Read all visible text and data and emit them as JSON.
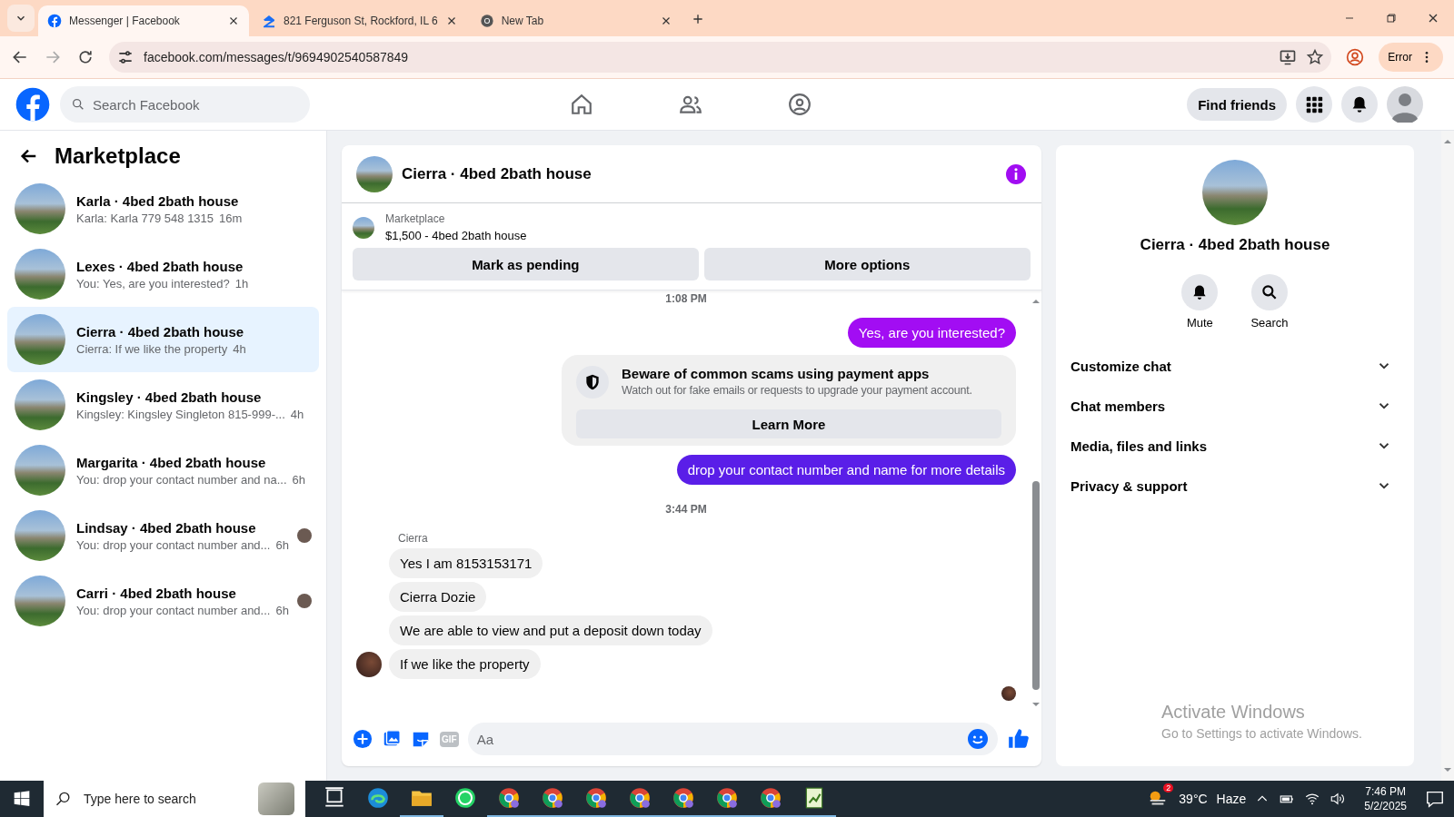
{
  "browser": {
    "tabs": [
      {
        "title": "Messenger | Facebook",
        "kind": "facebook",
        "selected": true
      },
      {
        "title": "821 Ferguson St, Rockford, IL 6",
        "kind": "realestate",
        "selected": false
      },
      {
        "title": "New Tab",
        "kind": "newtab",
        "selected": false
      }
    ],
    "url": "facebook.com/messages/t/9694902540587849",
    "profile_status": "Error"
  },
  "header": {
    "search_placeholder": "Search Facebook",
    "find_friends": "Find friends"
  },
  "sidebar": {
    "title": "Marketplace",
    "conversations": [
      {
        "name": "Karla · 4bed 2bath house",
        "preview": "Karla: Karla 779 548 1315",
        "time": "16m",
        "selected": false,
        "seen": false
      },
      {
        "name": "Lexes · 4bed 2bath house",
        "preview": "You: Yes, are you interested?",
        "time": "1h",
        "selected": false,
        "seen": false
      },
      {
        "name": "Cierra · 4bed 2bath house",
        "preview": "Cierra: If we like the property",
        "time": "4h",
        "selected": true,
        "seen": false
      },
      {
        "name": "Kingsley · 4bed 2bath house",
        "preview": "Kingsley: Kingsley Singleton 815-999-...",
        "time": "4h",
        "selected": false,
        "seen": false
      },
      {
        "name": "Margarita · 4bed 2bath house",
        "preview": "You: drop your contact number and na...",
        "time": "6h",
        "selected": false,
        "seen": false
      },
      {
        "name": "Lindsay · 4bed 2bath house",
        "preview": "You: drop your contact number and...",
        "time": "6h",
        "selected": false,
        "seen": true
      },
      {
        "name": "Carri · 4bed 2bath house",
        "preview": "You: drop your contact number and...",
        "time": "6h",
        "selected": false,
        "seen": true
      }
    ]
  },
  "chat": {
    "title": "Cierra · 4bed 2bath house",
    "listing": {
      "source": "Marketplace",
      "summary": "$1,500 - 4bed 2bath house"
    },
    "actions": [
      "Mark as pending",
      "More options"
    ],
    "messages": [
      {
        "kind": "time",
        "text": "1:08 PM"
      },
      {
        "kind": "sent",
        "text": "Yes, are you interested?",
        "color": "#a20df3"
      },
      {
        "kind": "notice",
        "title": "Beware of common scams using payment apps",
        "text": "Watch out for fake emails or requests to upgrade your payment account.",
        "button": "Learn More"
      },
      {
        "kind": "sent",
        "text": "drop your contact number and name for more details",
        "color": "#5a1ee8"
      },
      {
        "kind": "time",
        "text": "3:44 PM"
      },
      {
        "kind": "sender",
        "text": "Cierra"
      },
      {
        "kind": "received",
        "text": "Yes I am 8153153171",
        "avatar": false
      },
      {
        "kind": "received",
        "text": "Cierra Dozie",
        "avatar": false
      },
      {
        "kind": "received",
        "text": "We are able to view and put a deposit down today",
        "avatar": false
      },
      {
        "kind": "received",
        "text": "If we like the property",
        "avatar": true
      },
      {
        "kind": "seen"
      }
    ],
    "composer": {
      "placeholder": "Aa",
      "gif_label": "GIF"
    }
  },
  "details": {
    "title": "Cierra · 4bed 2bath house",
    "actions": [
      {
        "label": "Mute",
        "kind": "mute"
      },
      {
        "label": "Search",
        "kind": "search"
      }
    ],
    "sections": [
      {
        "label": "Customize chat",
        "expanded": false
      },
      {
        "label": "Chat members",
        "expanded": false
      },
      {
        "label": "Media, files and links",
        "expanded": false
      },
      {
        "label": "Privacy & support",
        "expanded": false
      }
    ]
  },
  "activation_notice": {
    "title": "Activate Windows",
    "text": "Go to Settings to activate Windows."
  },
  "taskbar": {
    "search_placeholder": "Type here to search",
    "weather_badge": "2",
    "temperature": "39°C",
    "condition": "Haze",
    "time": "7:46 PM",
    "date": "5/2/2025"
  }
}
